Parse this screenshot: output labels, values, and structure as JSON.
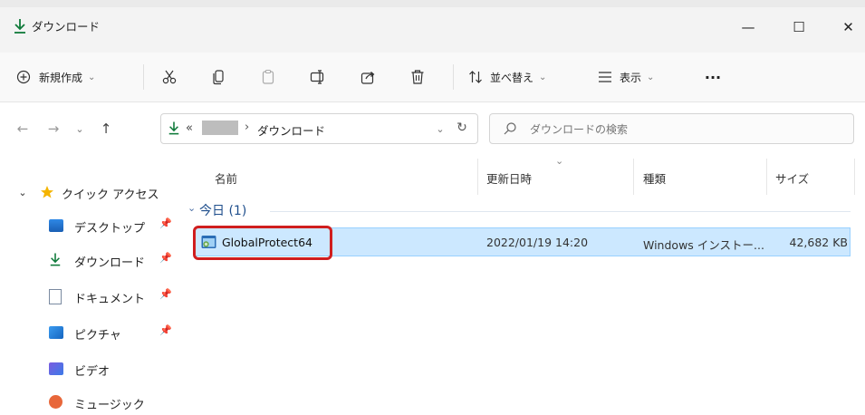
{
  "window": {
    "title": "ダウンロード",
    "accent": "#0f7a3a",
    "buttons": {
      "minimize": "—",
      "maximize": "☐",
      "close": "✕"
    }
  },
  "toolbar": {
    "new_label": "新規作成",
    "sort_label": "並べ替え",
    "view_label": "表示",
    "more_label": "···",
    "icons": [
      "new-icon",
      "cut-icon",
      "copy-icon",
      "paste-icon",
      "rename-icon",
      "share-icon",
      "delete-icon",
      "sort-icon",
      "view-icon",
      "more-icon"
    ]
  },
  "address": {
    "prefix": "«",
    "separator": "›",
    "current": "ダウンロード"
  },
  "search": {
    "placeholder": "ダウンロードの検索"
  },
  "sidebar": {
    "quick_access": "クイック アクセス",
    "items": [
      {
        "label": "デスクトップ",
        "icon": "desktop-icon",
        "pinned": true
      },
      {
        "label": "ダウンロード",
        "icon": "download-icon",
        "pinned": true
      },
      {
        "label": "ドキュメント",
        "icon": "document-icon",
        "pinned": true
      },
      {
        "label": "ピクチャ",
        "icon": "pictures-icon",
        "pinned": true
      },
      {
        "label": "ビデオ",
        "icon": "videos-icon",
        "pinned": false
      },
      {
        "label": "ミュージック",
        "icon": "music-icon",
        "pinned": false
      }
    ]
  },
  "columns": {
    "name": "名前",
    "date": "更新日時",
    "type": "種類",
    "size": "サイズ"
  },
  "group": {
    "label": "今日 (1)"
  },
  "files": [
    {
      "name": "GlobalProtect64",
      "date": "2022/01/19 14:20",
      "type": "Windows インストー...",
      "size": "42,682 KB",
      "selected": true
    }
  ]
}
